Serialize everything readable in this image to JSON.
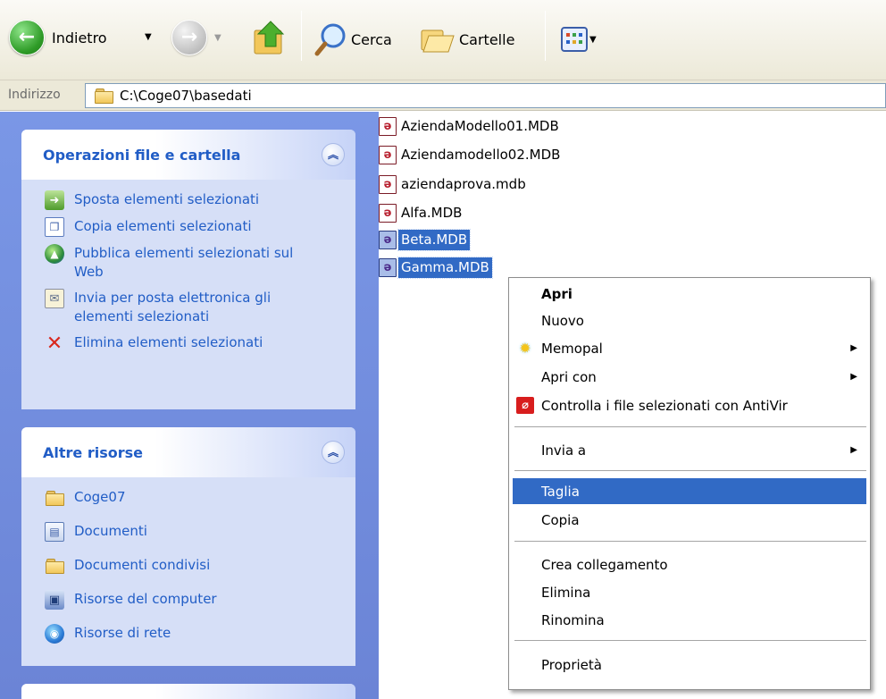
{
  "toolbar": {
    "back_label": "Indietro",
    "search_label": "Cerca",
    "folders_label": "Cartelle"
  },
  "address": {
    "label": "Indirizzo",
    "path": "C:\\Coge07\\basedati"
  },
  "file_tasks": {
    "title": "Operazioni file e cartella",
    "items": [
      {
        "label": "Sposta elementi selezionati",
        "icon": "move-icon"
      },
      {
        "label": "Copia elementi selezionati",
        "icon": "copy-icon"
      },
      {
        "label": "Pubblica elementi selezionati sul Web",
        "icon": "web-publish-icon"
      },
      {
        "label": "Invia per posta elettronica gli elementi selezionati",
        "icon": "email-icon"
      },
      {
        "label": "Elimina elementi selezionati",
        "icon": "delete-icon"
      }
    ]
  },
  "other_places": {
    "title": "Altre risorse",
    "items": [
      {
        "label": "Coge07",
        "icon": "folder-icon"
      },
      {
        "label": "Documenti",
        "icon": "documents-icon"
      },
      {
        "label": "Documenti condivisi",
        "icon": "folder-icon"
      },
      {
        "label": "Risorse del computer",
        "icon": "computer-icon"
      },
      {
        "label": "Risorse di rete",
        "icon": "network-icon"
      }
    ]
  },
  "files": [
    {
      "name": "AziendaModello01.MDB",
      "selected": false
    },
    {
      "name": "Aziendamodello02.MDB",
      "selected": false
    },
    {
      "name": "aziendaprova.mdb",
      "selected": false
    },
    {
      "name": "Alfa.MDB",
      "selected": false
    },
    {
      "name": "Beta.MDB",
      "selected": true
    },
    {
      "name": "Gamma.MDB",
      "selected": true
    }
  ],
  "context_menu": {
    "items": [
      {
        "label": "Apri",
        "bold": true
      },
      {
        "label": "Nuovo"
      },
      {
        "label": "Memopal",
        "submenu": true,
        "icon": "memopal-icon"
      },
      {
        "label": "Apri con",
        "submenu": true
      },
      {
        "label": "Controlla i file selezionati con AntiVir",
        "icon": "antivir-icon"
      },
      {
        "label": "Invia a",
        "submenu": true
      },
      {
        "label": "Taglia",
        "highlighted": true
      },
      {
        "label": "Copia"
      },
      {
        "label": "Crea collegamento"
      },
      {
        "label": "Elimina"
      },
      {
        "label": "Rinomina"
      },
      {
        "label": "Proprietà"
      }
    ]
  },
  "colors": {
    "link_blue": "#215dc6",
    "selection_blue": "#316ac5",
    "pane_blue": "#7a97e6"
  }
}
